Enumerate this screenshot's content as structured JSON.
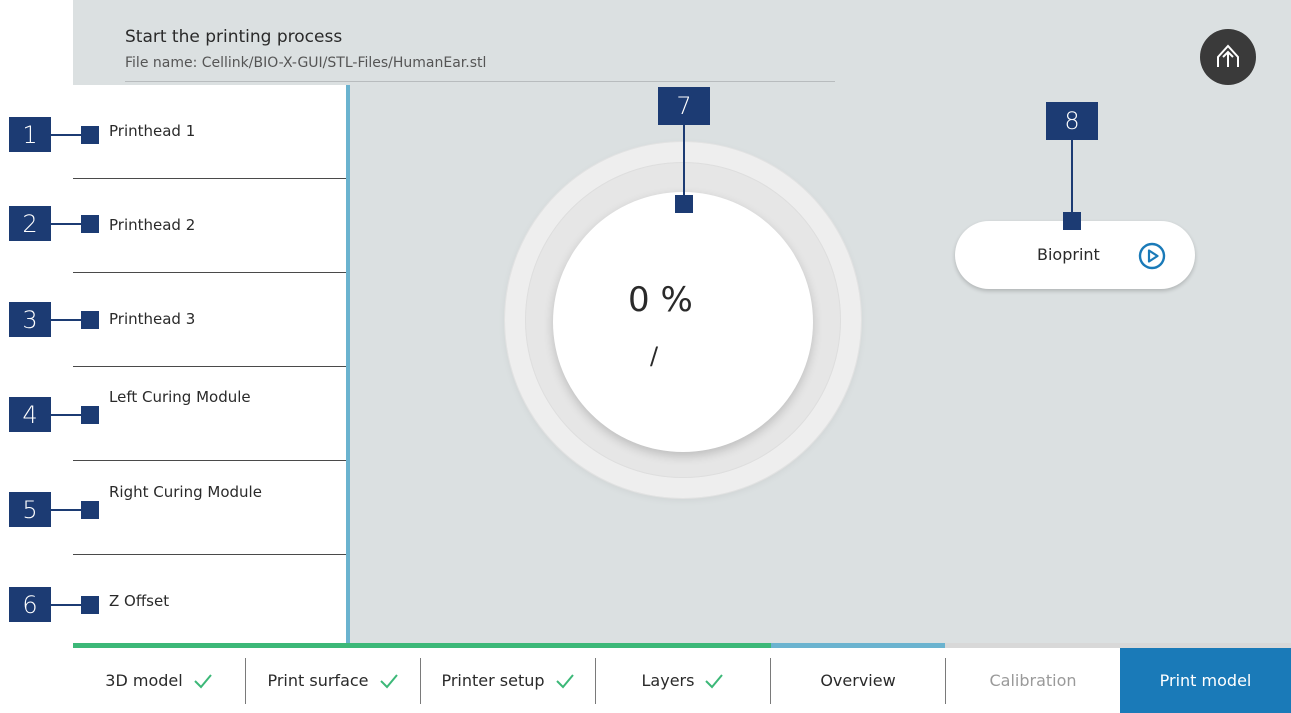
{
  "header": {
    "title": "Start the printing process",
    "file_name": "File name: Cellink/BIO-X-GUI/STL-Files/HumanEar.stl",
    "home_icon": "home-arrow-icon"
  },
  "sidebar": {
    "items": [
      {
        "label": "Printhead 1"
      },
      {
        "label": "Printhead 2"
      },
      {
        "label": "Printhead 3"
      },
      {
        "label": "Left Curing Module"
      },
      {
        "label": "Right Curing Module"
      },
      {
        "label": "Z Offset"
      }
    ]
  },
  "callouts": [
    "1",
    "2",
    "3",
    "4",
    "5",
    "6",
    "7",
    "8"
  ],
  "progress": {
    "value": "0 %",
    "sub": "/",
    "percent": 0
  },
  "actions": {
    "bioprint_label": "Bioprint",
    "bioprint_icon": "play-circle-icon"
  },
  "tabs": [
    {
      "label": "3D model",
      "done": true
    },
    {
      "label": "Print surface",
      "done": true
    },
    {
      "label": "Printer setup",
      "done": true
    },
    {
      "label": "Layers",
      "done": true
    },
    {
      "label": "Overview",
      "done": false
    },
    {
      "label": "Calibration",
      "done": false
    },
    {
      "label": "Print model",
      "done": false,
      "active": true
    }
  ],
  "colors": {
    "background": "#dbe0e1",
    "accent_blue": "#1a7ab8",
    "divider_blue": "#6bb3cf",
    "done_green": "#3cb878",
    "callout_navy": "#1c3b73",
    "home_button": "#3a3a3a",
    "disabled_text": "#9a9a9a"
  }
}
